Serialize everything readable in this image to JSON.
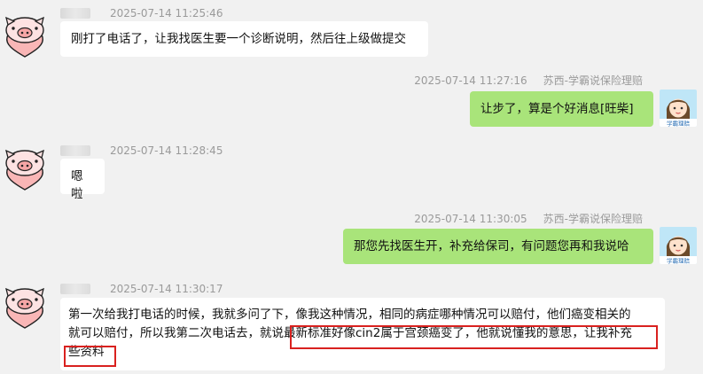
{
  "colors": {
    "background": "#f1f1f1",
    "incoming_bubble": "#ffffff",
    "outgoing_bubble": "#a9e47a",
    "highlight_box": "#d9211f",
    "timestamp_text": "#9a9a9a"
  },
  "messages": [
    {
      "direction": "incoming",
      "avatar_icon": "pig-heart-icon",
      "timestamp": "2025-07-14 11:25:46",
      "text": "刚打了电话了，让我找医生要一个诊断说明，然后往上级做提交"
    },
    {
      "direction": "outgoing",
      "avatar_icon": "agent-avatar-icon",
      "timestamp": "2025-07-14 11:27:16",
      "sender": "苏西-学霸说保险理赔",
      "text": "让步了，算是个好消息[旺柴]"
    },
    {
      "direction": "incoming",
      "avatar_icon": "pig-heart-icon",
      "timestamp": "2025-07-14 11:28:45",
      "text": "嗯啦"
    },
    {
      "direction": "outgoing",
      "avatar_icon": "agent-avatar-icon",
      "timestamp": "2025-07-14 11:30:05",
      "sender": "苏西-学霸说保险理赔",
      "text": "那您先找医生开，补充给保司，有问题您再和我说哈"
    },
    {
      "direction": "incoming",
      "avatar_icon": "pig-heart-icon",
      "timestamp": "2025-07-14 11:30:17",
      "line1": "第一次给我打电话的时候，我就多问了下，像我这种情况，相同的病症哪种情况可以赔付，他们癌变相关的",
      "line2_plain": "就可以赔付，所以我第二次电话去，就说",
      "line2_highlighted": "最新标准好像cin2属于宫颈癌变了，他就说懂我的意思，让我补充",
      "line3_highlighted": "些资料"
    }
  ],
  "agent_avatar_caption": "学霸理赔"
}
